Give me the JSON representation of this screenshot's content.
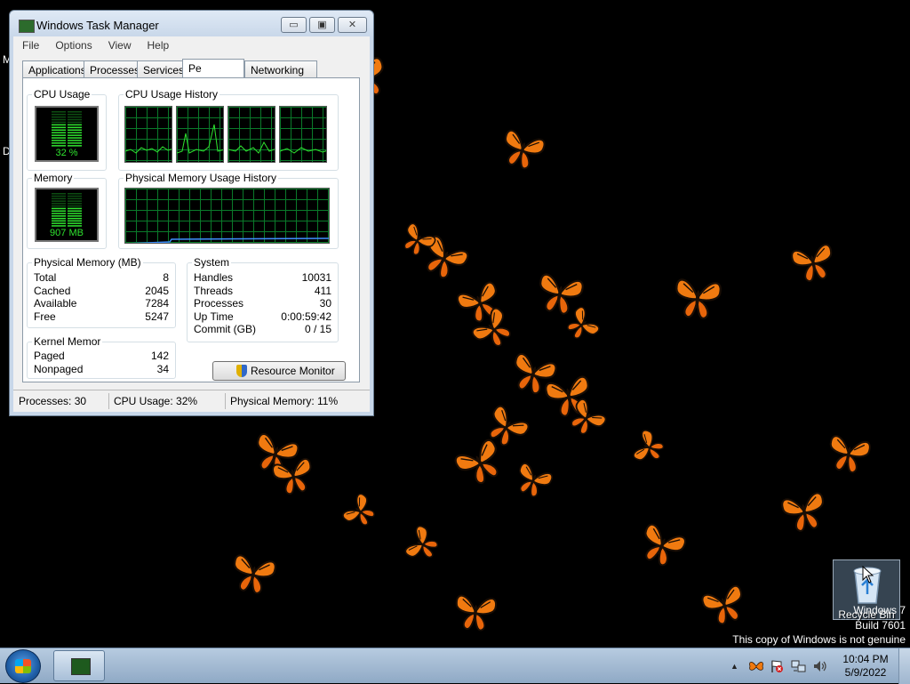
{
  "desktop": {
    "edge_letters": [
      "M",
      "D"
    ],
    "watermark": {
      "line1": "Windows 7",
      "line2": "Build 7601",
      "line3": "This copy of Windows is not genuine"
    },
    "recycle_bin": {
      "label": "Recycle Bin",
      "icon": "recycle-bin-icon"
    }
  },
  "task_manager": {
    "title": "Windows Task Manager",
    "caption_buttons": {
      "min": "▭",
      "max": "▣",
      "close": "✕"
    },
    "menu": [
      "File",
      "Options",
      "View",
      "Help"
    ],
    "tabs": [
      "Applications",
      "Processes",
      "Services",
      "Pe",
      "Networking"
    ],
    "active_tab_index": 3,
    "groups": {
      "cpu_usage": {
        "label": "CPU Usage",
        "value": "32 %"
      },
      "cpu_history": {
        "label": "CPU Usage History"
      },
      "memory": {
        "label": "Memory",
        "value": "907 MB"
      },
      "mem_history": {
        "label": "Physical Memory Usage History"
      }
    },
    "physical_memory": {
      "label": "Physical Memory (MB)",
      "rows": [
        {
          "k": "Total",
          "v": "8"
        },
        {
          "k": "Cached",
          "v": "2045"
        },
        {
          "k": "Available",
          "v": "7284"
        },
        {
          "k": "Free",
          "v": "5247"
        }
      ]
    },
    "kernel_memory": {
      "label": "Kernel Memor",
      "rows": [
        {
          "k": "Paged",
          "v": "142"
        },
        {
          "k": "Nonpaged",
          "v": "34"
        }
      ]
    },
    "system": {
      "label": "System",
      "rows": [
        {
          "k": "Handles",
          "v": "10031"
        },
        {
          "k": "Threads",
          "v": "411"
        },
        {
          "k": "Processes",
          "v": "30"
        },
        {
          "k": "Up Time",
          "v": "0:00:59:42"
        },
        {
          "k": "Commit (GB)",
          "v": "0 / 15"
        }
      ]
    },
    "resource_monitor_button": "Resource Monitor",
    "status": {
      "processes": "Processes: 30",
      "cpu": "CPU Usage: 32%",
      "memory": "Physical Memory: 11%"
    },
    "cpu_usage_fraction": 0.32,
    "memory_usage_fraction": 0.11
  },
  "taskbar": {
    "start_icon": "windows-start-icon",
    "pinned_app_icon": "task-manager-icon",
    "tray": {
      "show_hidden": "▲",
      "icons": [
        "butterfly-icon",
        "action-center-flag-icon",
        "network-icon",
        "volume-icon"
      ]
    },
    "clock": {
      "time": "10:04 PM",
      "date": "5/9/2022"
    }
  },
  "colors": {
    "meter_green": "#2fe32f",
    "grid_green": "#0a7a2a",
    "butterfly_orange": "#f07a10",
    "butterfly_dark": "#1a0e05"
  }
}
